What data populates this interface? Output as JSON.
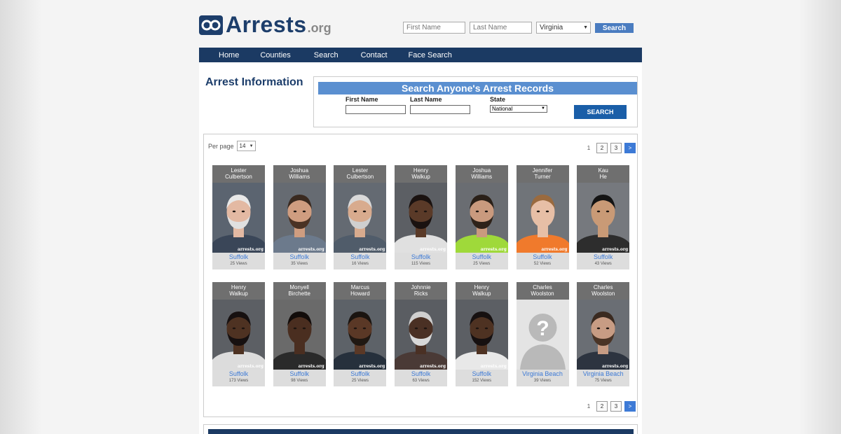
{
  "header": {
    "logo_text": "Arrests",
    "logo_suffix": ".org",
    "first_name_placeholder": "First Name",
    "last_name_placeholder": "Last Name",
    "state_selected": "Virginia",
    "search_label": "Search"
  },
  "nav": {
    "items": [
      {
        "label": "Home"
      },
      {
        "label": "Counties"
      },
      {
        "label": "Search"
      },
      {
        "label": "Contact"
      },
      {
        "label": "Face Search"
      }
    ]
  },
  "page": {
    "title": "Arrest Information"
  },
  "search_box": {
    "heading": "Search Anyone's Arrest Records",
    "first_name_label": "First Name",
    "last_name_label": "Last Name",
    "state_label": "State",
    "state_selected": "National",
    "button_label": "SEARCH"
  },
  "results": {
    "per_page_label": "Per page",
    "per_page_value": "14",
    "pagination": {
      "current": "1",
      "pages": [
        "2",
        "3"
      ],
      "next": ">"
    },
    "people": [
      {
        "first": "Lester",
        "last": "Culbertson",
        "county": "Suffolk",
        "views": "25 Views",
        "skin": "#e3b9a3",
        "hair": "#e8e8e8",
        "beard": "#e0e0e0",
        "shirt": "#3a4658",
        "bg": "#5b6470"
      },
      {
        "first": "Joshua",
        "last": "Williams",
        "county": "Suffolk",
        "views": "35 Views",
        "skin": "#cf9d80",
        "hair": "#3a2a20",
        "beard": "#4a3224",
        "shirt": "#6c7a8c",
        "bg": "#666b72"
      },
      {
        "first": "Lester",
        "last": "Culbertson",
        "county": "Suffolk",
        "views": "16 Views",
        "skin": "#d8ab8e",
        "hair": "#d9d9d9",
        "beard": "#cfcfcf",
        "shirt": "#505c6a",
        "bg": "#646a72"
      },
      {
        "first": "Henry",
        "last": "Walkup",
        "county": "Suffolk",
        "views": "115 Views",
        "skin": "#5a3a28",
        "hair": "#1a1210",
        "beard": "#1a1210",
        "shirt": "#e0e0e0",
        "bg": "#5c5f64"
      },
      {
        "first": "Joshua",
        "last": "Williams",
        "county": "Suffolk",
        "views": "25 Views",
        "skin": "#c99a7e",
        "hair": "#2a2018",
        "beard": "#2e2219",
        "shirt": "#9fd93a",
        "bg": "#6a6d72"
      },
      {
        "first": "Jennifer",
        "last": "Turner",
        "county": "Suffolk",
        "views": "52 Views",
        "skin": "#e7bfa6",
        "hair": "#9a6a3e",
        "beard": "",
        "shirt": "#f07a2c",
        "bg": "#707479"
      },
      {
        "first": "Kau",
        "last": "He",
        "county": "Suffolk",
        "views": "43 Views",
        "skin": "#c99a76",
        "hair": "#141414",
        "beard": "",
        "shirt": "#2d2d2d",
        "bg": "#76797e"
      },
      {
        "first": "Henry",
        "last": "Walkup",
        "county": "Suffolk",
        "views": "173 Views",
        "skin": "#4e3222",
        "hair": "#161010",
        "beard": "#161010",
        "shirt": "#dcdcdc",
        "bg": "#5c5f64"
      },
      {
        "first": "Monyell",
        "last": "Birchette",
        "county": "Suffolk",
        "views": "98 Views",
        "skin": "#4a2e20",
        "hair": "#120c0a",
        "beard": "",
        "shirt": "#2a2a2a",
        "bg": "#6a6a6a"
      },
      {
        "first": "Marcus",
        "last": "Howard",
        "county": "Suffolk",
        "views": "25 Views",
        "skin": "#5a3826",
        "hair": "#1a1410",
        "beard": "#201812",
        "shirt": "#26303c",
        "bg": "#5d6268"
      },
      {
        "first": "Johnnie",
        "last": "Ricks",
        "county": "Suffolk",
        "views": "63 Views",
        "skin": "#4a3024",
        "hair": "#cfcfcf",
        "beard": "#d8d8d8",
        "shirt": "#4a3a36",
        "bg": "#5a5d62"
      },
      {
        "first": "Henry",
        "last": "Walkup",
        "county": "Suffolk",
        "views": "152 Views",
        "skin": "#4e3222",
        "hair": "#161010",
        "beard": "#161010",
        "shirt": "#e8e8e8",
        "bg": "#5c5f64"
      },
      {
        "first": "Charles",
        "last": "Woolston",
        "county": "Virginia Beach",
        "views": "39 Views",
        "placeholder": true
      },
      {
        "first": "Charles",
        "last": "Woolston",
        "county": "Virginia Beach",
        "views": "75 Views",
        "skin": "#c79c84",
        "hair": "#3a2a20",
        "beard": "#4a3426",
        "shirt": "#2d3440",
        "bg": "#6a6e74"
      }
    ],
    "watermark": "arrests.org"
  },
  "colors": {
    "brand_dark": "#1b3a63",
    "accent_blue": "#3d7ad6",
    "search_bar": "#5a8fd0"
  }
}
